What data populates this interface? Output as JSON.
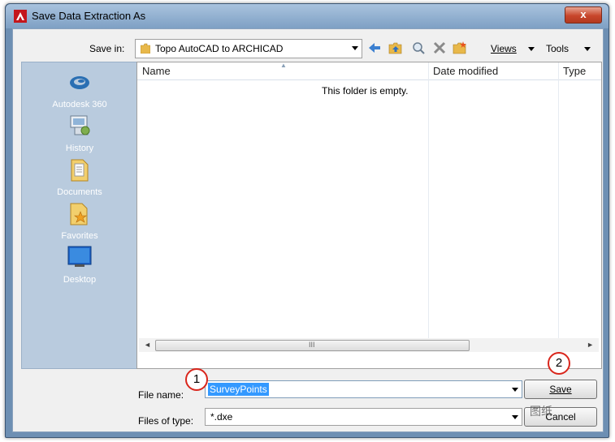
{
  "window": {
    "title": "Save Data Extraction As",
    "close_glyph": "x"
  },
  "toolbar": {
    "save_in_label": "Save in:",
    "save_in_value": "Topo AutoCAD to ARCHICAD",
    "views_label": "Views",
    "tools_label": "Tools",
    "icons": [
      "back-icon",
      "up-folder-icon",
      "search-web-icon",
      "delete-icon",
      "new-folder-icon"
    ]
  },
  "places": [
    {
      "label": "Autodesk 360",
      "icon": "autodesk-360-icon"
    },
    {
      "label": "History",
      "icon": "history-icon"
    },
    {
      "label": "Documents",
      "icon": "documents-folder-icon"
    },
    {
      "label": "Favorites",
      "icon": "favorites-folder-icon"
    },
    {
      "label": "Desktop",
      "icon": "desktop-icon"
    }
  ],
  "file_list": {
    "columns": [
      "Name",
      "Date modified",
      "Type"
    ],
    "empty_message": "This folder is empty.",
    "scroll_grip": "III"
  },
  "form": {
    "file_name_label": "File name:",
    "file_name_value": "SurveyPoints",
    "file_type_label": "Files of type:",
    "file_type_value": "*.dxe",
    "save_label": "Save",
    "cancel_label": "Cancel"
  },
  "callouts": [
    "1",
    "2"
  ],
  "watermark": "图纸",
  "colors": {
    "selection": "#3399ff",
    "callout_red": "#d9261c",
    "places_bg": "#b9cbde",
    "title_bar": "#8fb0d2"
  }
}
